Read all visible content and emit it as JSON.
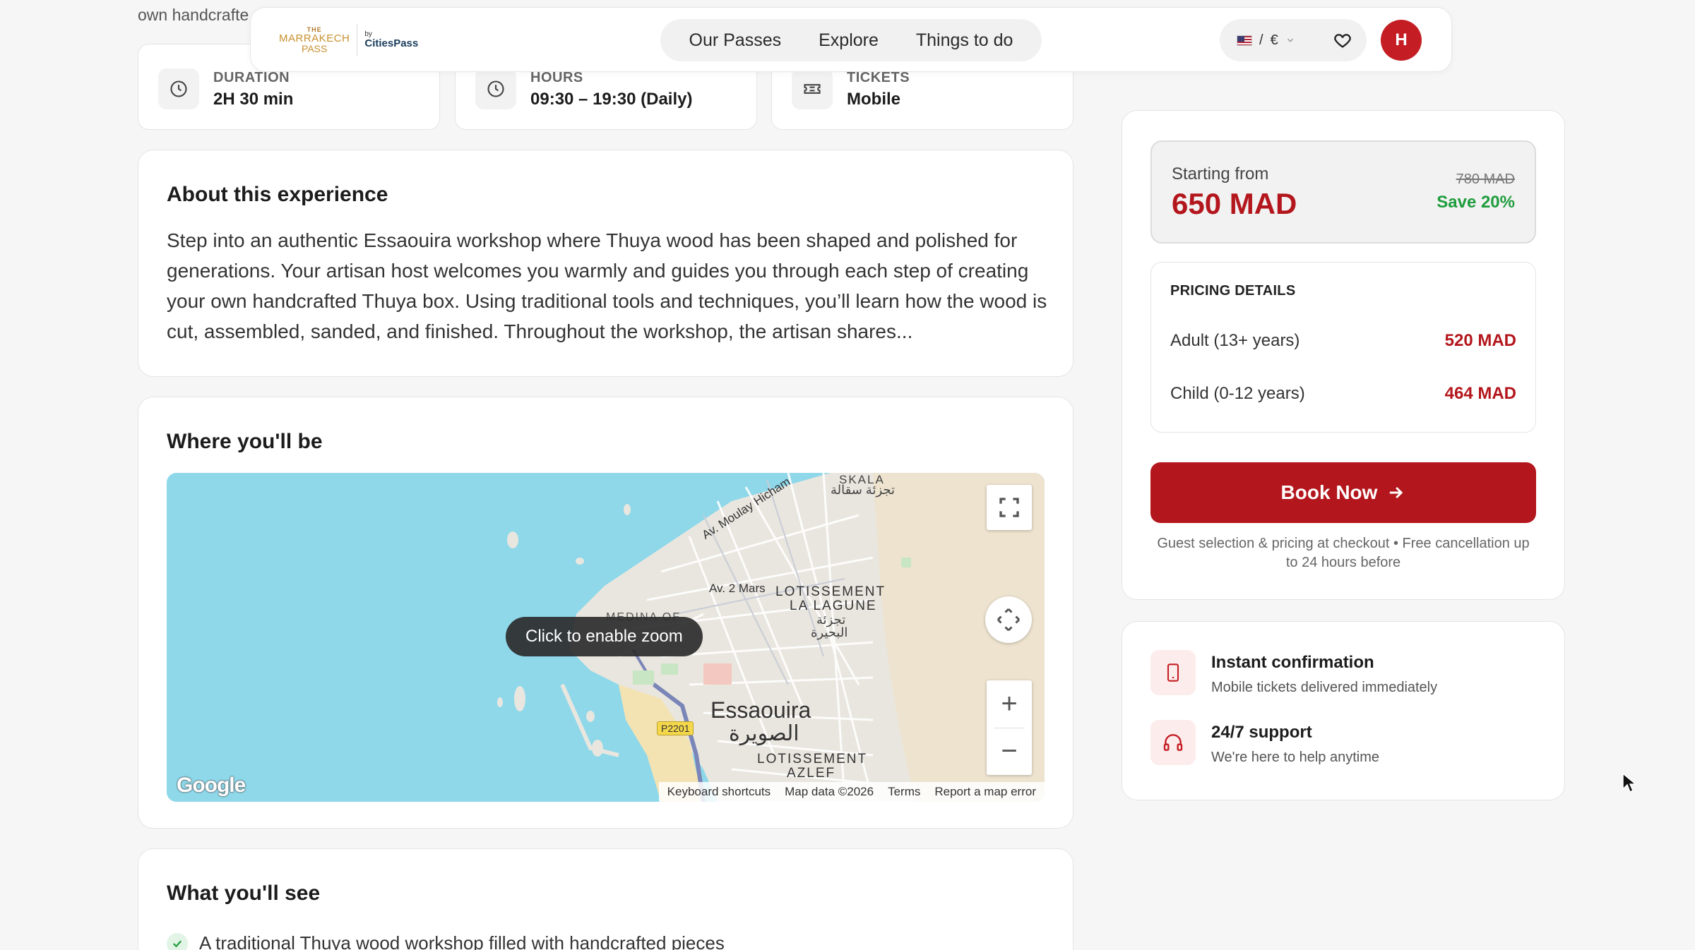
{
  "peek_text": "own handcrafte",
  "header": {
    "logo": {
      "the": "THE",
      "name": "MARRAKECH",
      "pass": "PASS",
      "by": "by",
      "brand": "CitiesPass"
    },
    "nav": [
      "Our Passes",
      "Explore",
      "Things to do"
    ],
    "locale": {
      "separator": "/",
      "currency": "€"
    },
    "avatar_initial": "H"
  },
  "info_cards": [
    {
      "label": "DURATION",
      "value": "2H 30 min",
      "icon": "clock-icon"
    },
    {
      "label": "HOURS",
      "value": "09:30 – 19:30 (Daily)",
      "icon": "clock-icon"
    },
    {
      "label": "TICKETS",
      "value": "Mobile",
      "icon": "ticket-icon"
    }
  ],
  "about": {
    "title": "About this experience",
    "text": "Step into an authentic Essaouira workshop where Thuya wood has been shaped and polished for generations. Your artisan host welcomes you warmly and guides you through each step of creating your own handcrafted Thuya box. Using traditional tools and techniques, you’ll learn how the wood is cut, assembled, sanded, and finished. Throughout the workshop, the artisan shares..."
  },
  "where": {
    "title": "Where you'll be",
    "map": {
      "zoom_tip": "Click to enable zoom",
      "city": "Essaouira",
      "city_ar": "الصويرة",
      "labels": {
        "skala": "SKALA",
        "skala_ar": "تجزئة سقالة",
        "moulay": "Av. Moulay Hicham",
        "mars": "Av. 2 Mars",
        "lotissement1": "LOTISSEMENT",
        "lagune": "LA LAGUNE",
        "lagune_ar1": "تجزئة",
        "lagune_ar2": "البحيرة",
        "medina": "MEDINA OF",
        "lotissement2": "LOTISSEMENT",
        "azlef": "AZLEF",
        "road": "P2201"
      },
      "google": "Google",
      "attribution": [
        "Keyboard shortcuts",
        "Map data ©2026",
        "Terms",
        "Report a map error"
      ]
    }
  },
  "see": {
    "title": "What you'll see",
    "items": [
      "A traditional Thuya wood workshop filled with handcrafted pieces"
    ]
  },
  "pricing": {
    "starting_label": "Starting from",
    "price": "650 MAD",
    "old_price": "780 MAD",
    "save": "Save 20%",
    "details_title": "PRICING DETAILS",
    "rows": [
      {
        "label": "Adult (13+ years)",
        "price": "520 MAD"
      },
      {
        "label": "Child (0-12 years)",
        "price": "464 MAD"
      }
    ],
    "book_label": "Book Now",
    "note": "Guest selection & pricing at checkout • Free cancellation up to 24 hours before"
  },
  "features": [
    {
      "title": "Instant confirmation",
      "subtitle": "Mobile tickets delivered immediately",
      "icon": "phone-icon"
    },
    {
      "title": "24/7 support",
      "subtitle": "We're here to help anytime",
      "icon": "headphones-icon"
    }
  ],
  "colors": {
    "accent": "#b3161c",
    "save_green": "#1f9d3d",
    "map_water": "#8ed8ea"
  }
}
